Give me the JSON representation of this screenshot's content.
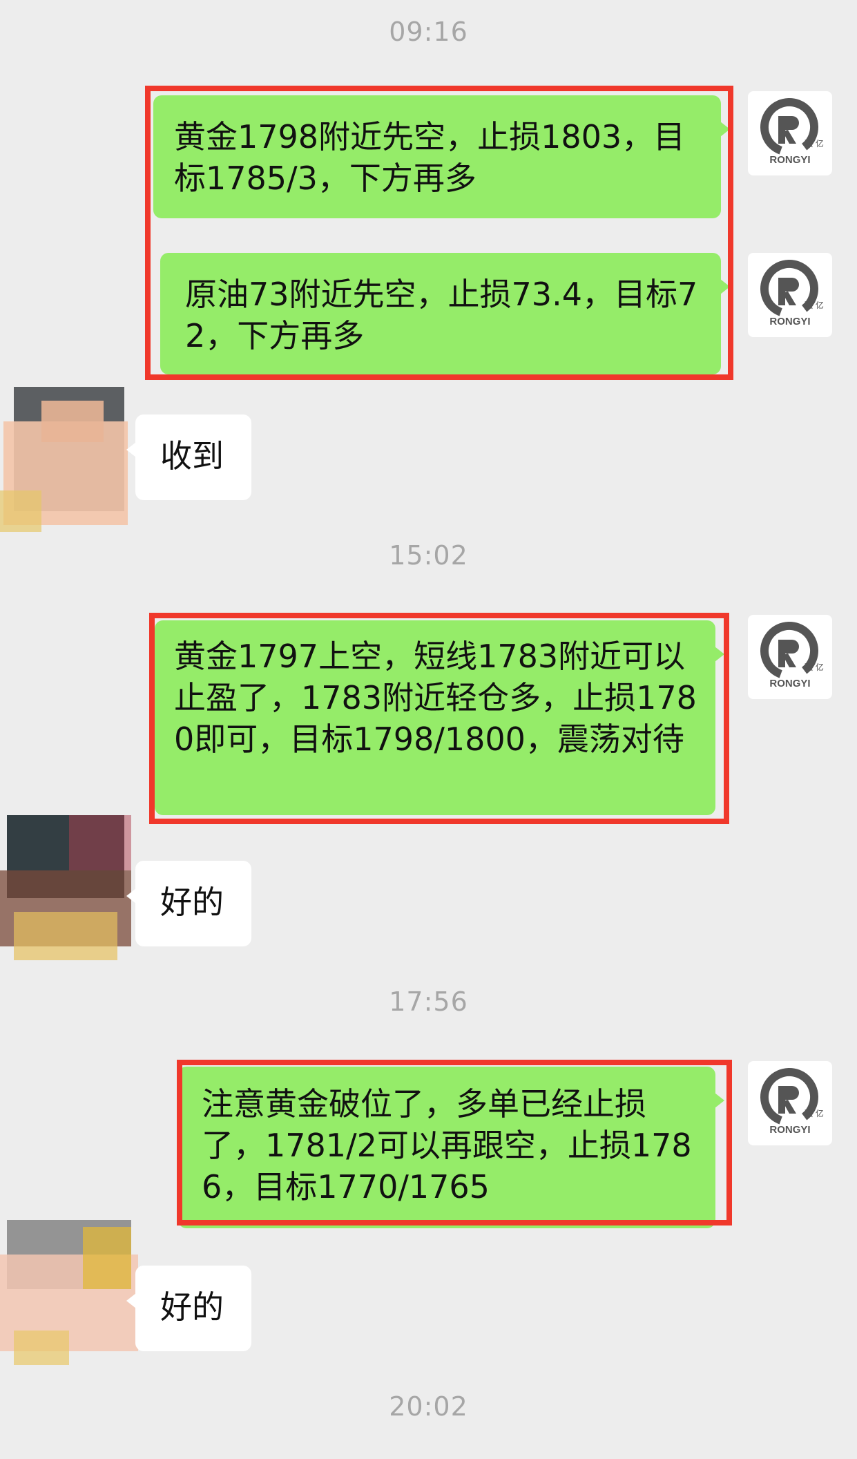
{
  "timestamps": [
    "09:16",
    "15:02",
    "17:56",
    "20:02"
  ],
  "brand": {
    "avatar_text": "RONGYI",
    "avatar_cn": "融 亿",
    "logo_color": "#555555"
  },
  "colors": {
    "sent_bubble": "#95ec69",
    "received_bubble": "#ffffff",
    "highlight_box": "#f0382b",
    "background": "#ededed"
  },
  "messages": {
    "m1": "黄金1798附近先空，止损1803，目标1785/3，下方再多",
    "m2": "原油73附近先空，止损73.4，目标72，下方再多",
    "r1": "收到",
    "m3": "黄金1797上空，短线1783附近可以止盈了，1783附近轻仓多，止损1780即可，目标1798/1800，震荡对待",
    "r2": "好的",
    "m4": "注意黄金破位了，多单已经止损了，1781/2可以再跟空，止损1786，目标1770/1765",
    "r3": "好的"
  }
}
